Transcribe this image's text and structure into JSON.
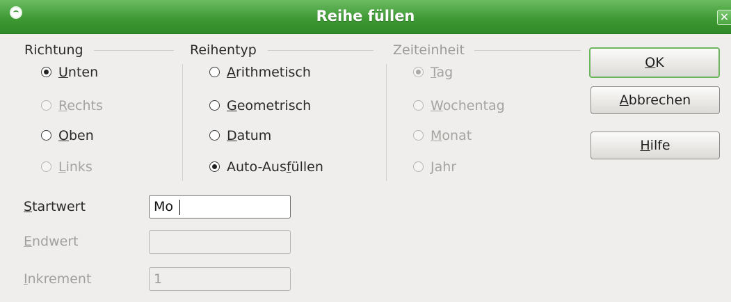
{
  "window": {
    "title": "Reihe füllen",
    "close_glyph": "✕"
  },
  "groups": {
    "richtung": {
      "label": "Richtung",
      "options": [
        {
          "pre": "",
          "key": "U",
          "post": "nten",
          "checked": true,
          "enabled": true
        },
        {
          "pre": "",
          "key": "R",
          "post": "echts",
          "checked": false,
          "enabled": false
        },
        {
          "pre": "",
          "key": "O",
          "post": "ben",
          "checked": false,
          "enabled": true
        },
        {
          "pre": "",
          "key": "L",
          "post": "inks",
          "checked": false,
          "enabled": false
        }
      ]
    },
    "reihentyp": {
      "label": "Reihentyp",
      "options": [
        {
          "pre": "",
          "key": "A",
          "post": "rithmetisch",
          "checked": false,
          "enabled": true
        },
        {
          "pre": "",
          "key": "G",
          "post": "eometrisch",
          "checked": false,
          "enabled": true
        },
        {
          "pre": "",
          "key": "D",
          "post": "atum",
          "checked": false,
          "enabled": true
        },
        {
          "pre": "Auto-Aus",
          "key": "f",
          "post": "üllen",
          "checked": true,
          "enabled": true
        }
      ]
    },
    "zeiteinheit": {
      "label": "Zeiteinheit",
      "options": [
        {
          "pre": "",
          "key": "T",
          "post": "ag",
          "checked": true,
          "enabled": false
        },
        {
          "pre": "",
          "key": "W",
          "post": "ochentag",
          "checked": false,
          "enabled": false
        },
        {
          "pre": "",
          "key": "M",
          "post": "onat",
          "checked": false,
          "enabled": false
        },
        {
          "pre": "",
          "key": "J",
          "post": "ahr",
          "checked": false,
          "enabled": false
        }
      ]
    }
  },
  "fields": {
    "startwert": {
      "label_key": "S",
      "label_rest": "tartwert",
      "value": "Mo"
    },
    "endwert": {
      "label_key": "E",
      "label_rest": "ndwert",
      "value": ""
    },
    "inkrement": {
      "label_key": "I",
      "label_rest": "nkrement",
      "value": "1"
    }
  },
  "buttons": {
    "ok": {
      "key": "O",
      "rest": "K"
    },
    "abbrechen": {
      "key": "A",
      "rest": "bbrechen"
    },
    "hilfe": {
      "key": "H",
      "rest": "ilfe"
    }
  },
  "colors": {
    "titlebar": "#3f9a35",
    "default_button_border": "#6cb45d",
    "background": "#efeeec"
  }
}
